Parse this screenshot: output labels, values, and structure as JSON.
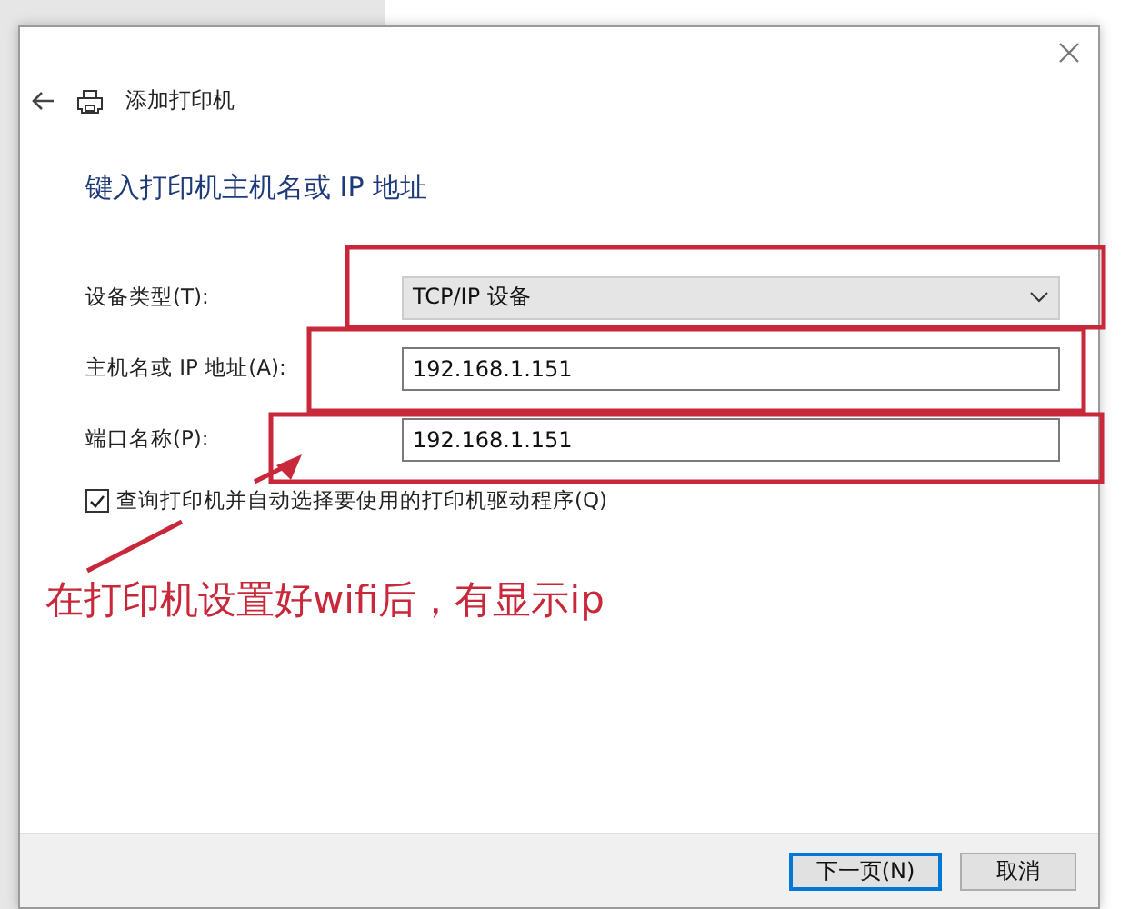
{
  "dialog": {
    "title": "添加打印机",
    "heading": "键入打印机主机名或 IP 地址",
    "fields": [
      {
        "kind": "dropdown",
        "label": "设备类型(T):",
        "value": "TCP/IP 设备"
      },
      {
        "kind": "text",
        "label": "主机名或 IP 地址(A):",
        "value": "192.168.1.151"
      },
      {
        "kind": "text",
        "label": "端口名称(P):",
        "value": "192.168.1.151"
      }
    ],
    "query_driver": {
      "label": "查询打印机并自动选择要使用的打印机驱动程序(Q)",
      "checked": true
    },
    "buttons": [
      {
        "label": "下一页(N)",
        "default": true
      },
      {
        "label": "取消",
        "default": false
      }
    ]
  },
  "annotation": {
    "text": "在打印机设置好wifi后，有显示ip"
  }
}
